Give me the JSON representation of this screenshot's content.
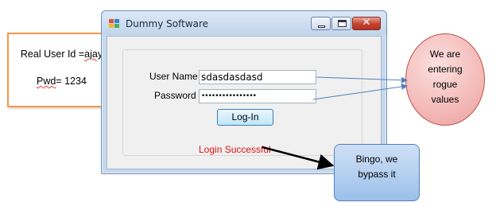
{
  "window": {
    "title": "Dummy Software",
    "close_glyph": "✕"
  },
  "form": {
    "username_label": "User Name",
    "password_label": "Password",
    "username_value": "sdasdasdasd",
    "password_mask": "••••••••••••••••",
    "login_button": "Log-In",
    "status_text": "Login Successful",
    "status_color": "#e01010"
  },
  "annotations": {
    "credentials_line1_prefix": "Real User Id =",
    "credentials_line1_id": "ajay",
    "credentials_line2_key": "Pwd",
    "credentials_line2_rest": "= 1234",
    "ellipse_text": [
      "We are",
      "entering",
      "rogue",
      "values"
    ],
    "callout_text": [
      "Bingo, we",
      "bypass it"
    ]
  },
  "icons": {
    "app": "app-icon",
    "minimize": "minimize-icon",
    "maximize": "maximize-icon",
    "close": "close-icon"
  }
}
